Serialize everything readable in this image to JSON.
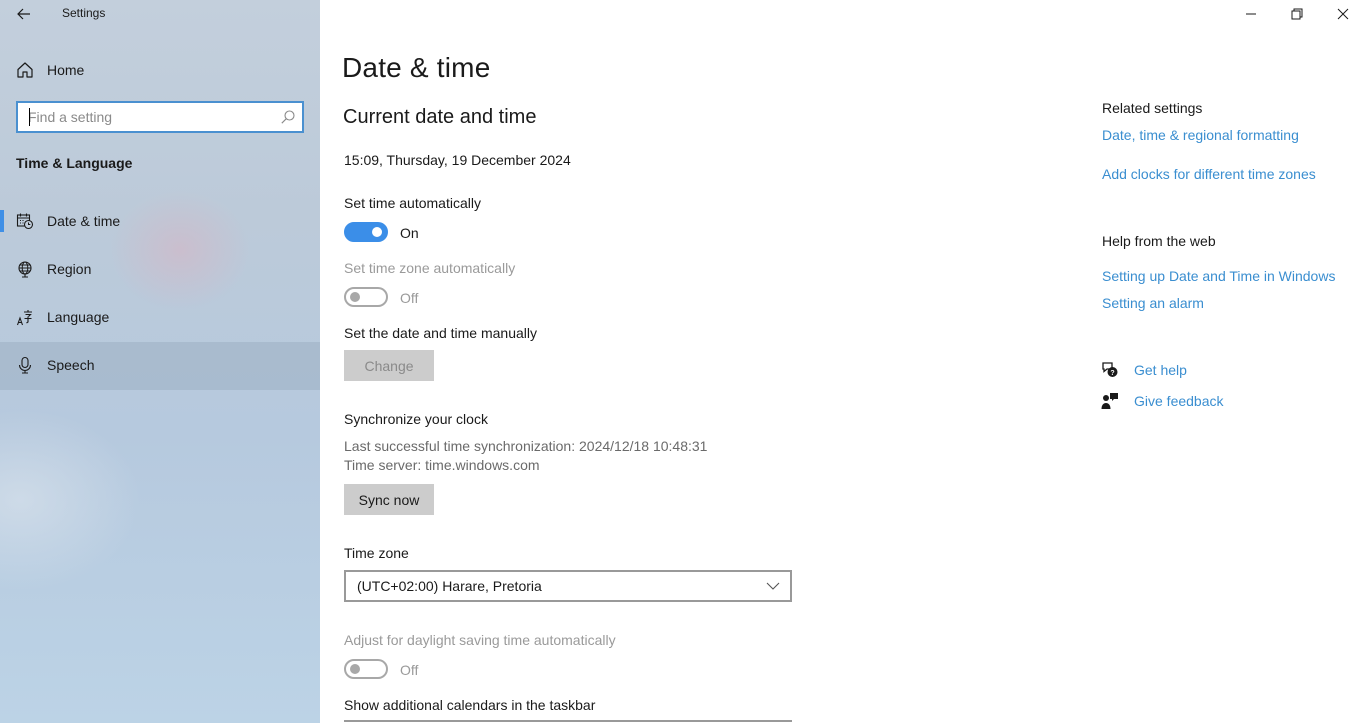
{
  "window": {
    "app_title": "Settings",
    "controls": {
      "minimize_icon": "minimize-icon",
      "restore_icon": "restore-icon",
      "close_icon": "close-icon"
    }
  },
  "sidebar": {
    "back_icon": "back-arrow-icon",
    "home": {
      "label": "Home",
      "icon": "home-icon"
    },
    "search": {
      "placeholder": "Find a setting",
      "value": "",
      "icon": "search-icon"
    },
    "section_title": "Time & Language",
    "items": [
      {
        "label": "Date & time",
        "icon": "calendar-clock-icon",
        "active": true
      },
      {
        "label": "Region",
        "icon": "globe-icon",
        "active": false
      },
      {
        "label": "Language",
        "icon": "language-icon",
        "active": false
      },
      {
        "label": "Speech",
        "icon": "microphone-icon",
        "active": false,
        "hovered": true
      }
    ],
    "accent_color": "#3f8fe6"
  },
  "main": {
    "page_title": "Date & time",
    "current": {
      "heading": "Current date and time",
      "value": "15:09, Thursday, 19 December 2024"
    },
    "set_time_auto": {
      "label": "Set time automatically",
      "state": "On",
      "enabled": true
    },
    "set_timezone_auto": {
      "label": "Set time zone automatically",
      "state": "Off",
      "enabled": false
    },
    "manual": {
      "label": "Set the date and time manually",
      "button": "Change",
      "button_enabled": false
    },
    "sync": {
      "heading": "Synchronize your clock",
      "last_sync": "Last successful time synchronization: 2024/12/18 10:48:31",
      "server": "Time server: time.windows.com",
      "button": "Sync now"
    },
    "timezone": {
      "label": "Time zone",
      "selected": "(UTC+02:00) Harare, Pretoria"
    },
    "dst": {
      "label": "Adjust for daylight saving time automatically",
      "state": "Off",
      "enabled": false
    },
    "additional_calendars": {
      "label": "Show additional calendars in the taskbar"
    },
    "toggle_on_color": "#3b8ee8"
  },
  "related": {
    "title": "Related settings",
    "links": [
      "Date, time & regional formatting",
      "Add clocks for different time zones"
    ]
  },
  "help": {
    "title": "Help from the web",
    "links": [
      "Setting up Date and Time in Windows",
      "Setting an alarm"
    ]
  },
  "support": {
    "get_help": "Get help",
    "give_feedback": "Give feedback"
  },
  "link_color": "#3a8ed0"
}
